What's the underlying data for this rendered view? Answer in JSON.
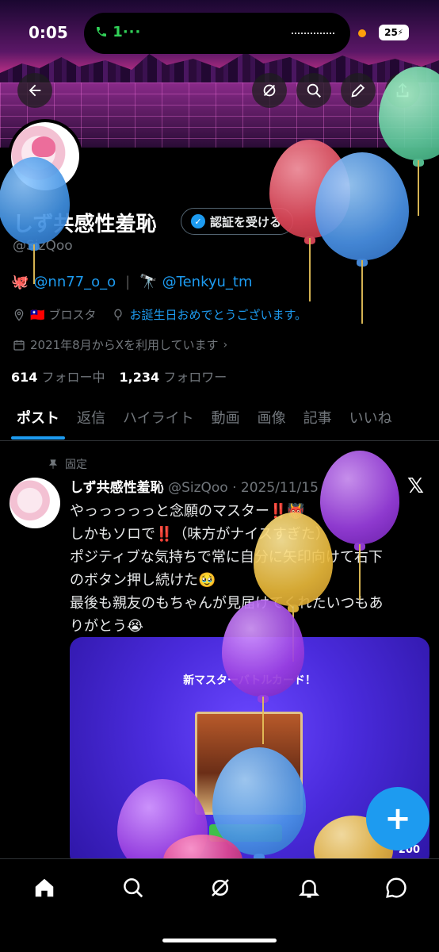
{
  "status_bar": {
    "time": "0:05",
    "call_label": "1",
    "battery": "25"
  },
  "header": {
    "buttons": [
      "back-arrow-icon",
      "grok-icon",
      "search-icon",
      "edit-icon",
      "share-icon"
    ]
  },
  "profile": {
    "display_name": "しず共感性羞恥",
    "verify_label": "認証を受ける",
    "handle": "@SizQoo",
    "bio_links": [
      {
        "emoji": "🐙",
        "text": "@nn77_o_o"
      },
      {
        "emoji": "🔭",
        "text": "@Tenkyu_tm"
      }
    ],
    "location": "🇹🇼 ブロスタ",
    "birthday": "お誕生日おめでとうございます。",
    "joined": "2021年8月からXを利用しています",
    "following_count": "614",
    "following_label": "フォロー中",
    "followers_count": "1,234",
    "followers_label": "フォロワー"
  },
  "tabs": [
    "ポスト",
    "返信",
    "ハイライト",
    "動画",
    "画像",
    "記事",
    "いいね"
  ],
  "post": {
    "pinned_label": "固定",
    "author": "しず共感性羞恥",
    "handle_date": "@SizQoo · 2025/11/15",
    "lines": [
      "やっっっっっと念願のマスター‼️👹",
      "しかもソロで‼️（味方がナイスすぎた）",
      "ポジティブな気持ちで常に自分に矢印向けて右下",
      "のボタン押し続けた🥹",
      "最後も親友のもちゃんが見届けてくれたいつもあ",
      "りがとう😭"
    ],
    "media_caption": "新マスターバトルカード！",
    "media_score": "200"
  },
  "colors": {
    "accent": "#1d9bf0",
    "background": "#000000",
    "muted": "#71767b"
  }
}
